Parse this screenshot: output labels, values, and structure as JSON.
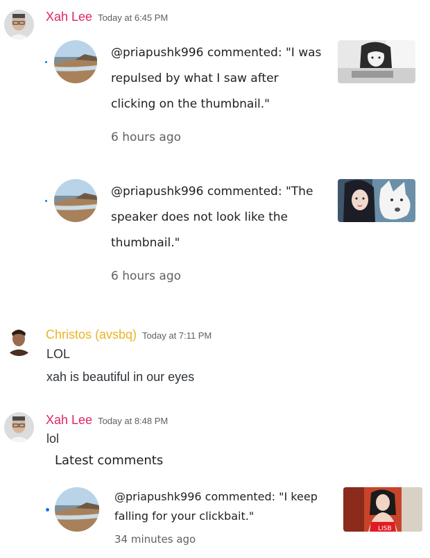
{
  "messages": [
    {
      "username": "Xah Lee",
      "username_color": "#e0245e",
      "timestamp": "Today at 6:45 PM",
      "notifications": [
        {
          "text": "@priapushk996 commented: \"I was repulsed by what I saw after clicking on the thumbnail.\"",
          "time": "6 hours ago",
          "thumb_icon": "anime-girl-at-computer-thumbnail"
        },
        {
          "text": "@priapushk996 commented: \"The speaker does not look like the thumbnail.\"",
          "time": "6 hours ago",
          "thumb_icon": "girl-with-white-wolf-thumbnail"
        }
      ]
    },
    {
      "username": "Christos (avsbq)",
      "username_color": "#e8b325",
      "timestamp": "Today at 7:11 PM",
      "lines": [
        "LOL",
        "xah is beautiful in our eyes"
      ]
    },
    {
      "username": "Xah Lee",
      "username_color": "#e0245e",
      "timestamp": "Today at 8:48 PM",
      "lines": [
        "lol"
      ],
      "latest_header": "Latest comments",
      "latest_notification": {
        "text": "@priapushk996 commented: \"I keep falling for your clickbait.\"",
        "time": "34 minutes ago",
        "thumb_icon": "girl-in-red-thumbnail"
      }
    }
  ],
  "colors": {
    "unread_dot": "#1a73e8",
    "secondary_text": "#606060"
  }
}
